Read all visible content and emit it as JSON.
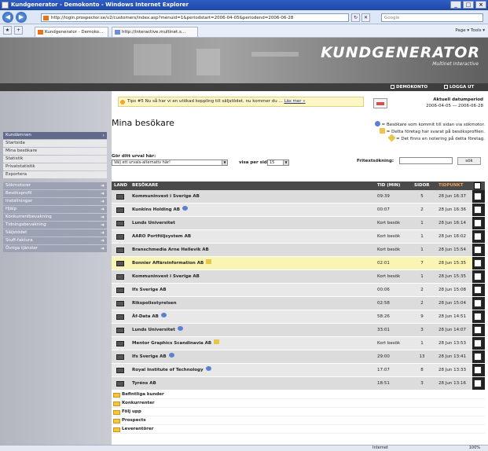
{
  "window": {
    "title": "Kundgenerator - Demokonto - Windows Internet Explorer",
    "controls": [
      "_",
      "□",
      "×"
    ]
  },
  "browser": {
    "url": "http://login.prospector.se/v2/customers/index.asp?menuid=1&periodstart=2006-04-05&periodend=2006-06-28",
    "search_placeholder": "Google",
    "tabs": [
      {
        "label": "Kundgenerator - Demoko..."
      },
      {
        "label": "http://interactive.multinet.s..."
      }
    ],
    "toolbar_right": "Page ▾  Tools ▾"
  },
  "brand": {
    "title": "KUNDGENERATOR",
    "subtitle": "Multinet Interactive"
  },
  "login_bar": {
    "account": "DEMOKONTO",
    "logout": "LOGGA UT"
  },
  "sidebar": {
    "items": [
      {
        "label": "Kundämnen",
        "style": "dark",
        "arrow": "›"
      },
      {
        "label": "Startsida",
        "style": "light",
        "arrow": ""
      },
      {
        "label": "Mina besökare",
        "style": "light",
        "arrow": ""
      },
      {
        "label": "Statistik",
        "style": "light",
        "arrow": ""
      },
      {
        "label": "Privatstatistik",
        "style": "light",
        "arrow": ""
      },
      {
        "label": "Exportera",
        "style": "light",
        "arrow": ""
      },
      {
        "label": "Sökmotorer",
        "style": "grey",
        "arrow": "➜"
      },
      {
        "label": "Besöksprofil",
        "style": "grey",
        "arrow": "➜"
      },
      {
        "label": "Inställningar",
        "style": "grey",
        "arrow": "➜"
      },
      {
        "label": "Hjälp",
        "style": "grey",
        "arrow": "➜"
      },
      {
        "label": "Konkurrentbevakning",
        "style": "grey",
        "arrow": "➜"
      },
      {
        "label": "Tidningsbevakning",
        "style": "grey",
        "arrow": "➜"
      },
      {
        "label": "Säljstödet",
        "style": "grey",
        "arrow": "➜"
      },
      {
        "label": "Stuff-faktura",
        "style": "grey",
        "arrow": "➜"
      },
      {
        "label": "Övriga tjänster",
        "style": "grey",
        "arrow": "➜"
      }
    ]
  },
  "tip": {
    "text": "Tips #5 Nu så har vi en utökad koppling till säljstödet, nu kommer du ...",
    "link": "Läs mer »"
  },
  "period": {
    "label": "Aktuell datumperiod",
    "range": "2006-04-05 — 2006-06-28"
  },
  "page_title": "Mina besökare",
  "legend": [
    {
      "text": "= Besökare som kommit till sidan via sökmotor.",
      "color": "#5c7fd0"
    },
    {
      "text": "= Detta företag har svarat på besöksprofilen.",
      "color": "#f2c14e"
    },
    {
      "text": "= Det finns en notering på detta företag.",
      "color": "#e6c74a"
    }
  ],
  "filters": {
    "choose_label": "Gör ditt urval här:",
    "choose_value": "Välj ett urvals-alternativ här!",
    "per_page_label": "visa per sida",
    "per_page_value": "15",
    "freetext_label": "Fritextsökning:",
    "search_button": "sök"
  },
  "table": {
    "columns": [
      "LAND",
      "BESÖKARE",
      "TID (MIN)",
      "SIDOR",
      "TIDPUNKT"
    ],
    "rows": [
      {
        "name": "Kommuninvest i Sverige AB",
        "time": "09:39",
        "pages": "5",
        "when": "28 Jun 16:37",
        "icon": ""
      },
      {
        "name": "Kunkins Holding AB",
        "time": "00:07",
        "pages": "2",
        "when": "28 Jun 16:36",
        "icon": "search"
      },
      {
        "name": "Lunds Universitet",
        "time": "Kort besök",
        "pages": "1",
        "when": "28 Jun 16:14",
        "icon": ""
      },
      {
        "name": "AARO Portföljsystem AB",
        "time": "Kort besök",
        "pages": "1",
        "when": "28 Jun 16:02",
        "icon": ""
      },
      {
        "name": "Branschmedia Arne Hellevik AB",
        "time": "Kort besök",
        "pages": "1",
        "when": "28 Jun 15:54",
        "icon": ""
      },
      {
        "name": "Bonnier Affärsinformation AB",
        "time": "02:01",
        "pages": "7",
        "when": "28 Jun 15:35",
        "icon": "note",
        "highlight": true
      },
      {
        "name": "Kommuninvest i Sverige AB",
        "time": "Kort besök",
        "pages": "1",
        "when": "28 Jun 15:35",
        "icon": ""
      },
      {
        "name": "Ifs Sverige AB",
        "time": "00:06",
        "pages": "2",
        "when": "28 Jun 15:08",
        "icon": ""
      },
      {
        "name": "Rikspolisstyrelsen",
        "time": "02:58",
        "pages": "2",
        "when": "28 Jun 15:04",
        "icon": ""
      },
      {
        "name": "Äf-Data AB",
        "time": "58:26",
        "pages": "9",
        "when": "28 Jun 14:51",
        "icon": "search"
      },
      {
        "name": "Lunds Universitet",
        "time": "33:01",
        "pages": "3",
        "when": "28 Jun 14:07",
        "icon": "search"
      },
      {
        "name": "Mentor Graphics Scandinavia AB",
        "time": "Kort besök",
        "pages": "1",
        "when": "28 Jun 13:53",
        "icon": "note"
      },
      {
        "name": "Ifs Sverige AB",
        "time": "29:00",
        "pages": "13",
        "when": "28 Jun 13:41",
        "icon": "search"
      },
      {
        "name": "Royal Institute of Technology",
        "time": "17:07",
        "pages": "8",
        "when": "28 Jun 13:33",
        "icon": "search"
      },
      {
        "name": "Tyréns AB",
        "time": "18:51",
        "pages": "3",
        "when": "28 Jun 13:16",
        "icon": ""
      }
    ]
  },
  "groups": [
    "Befintliga kunder",
    "Konkurrenter",
    "Följ upp",
    "Prospects",
    "Leverantörer"
  ],
  "statusbar": {
    "zone": "Internet",
    "zoom": "100%"
  }
}
